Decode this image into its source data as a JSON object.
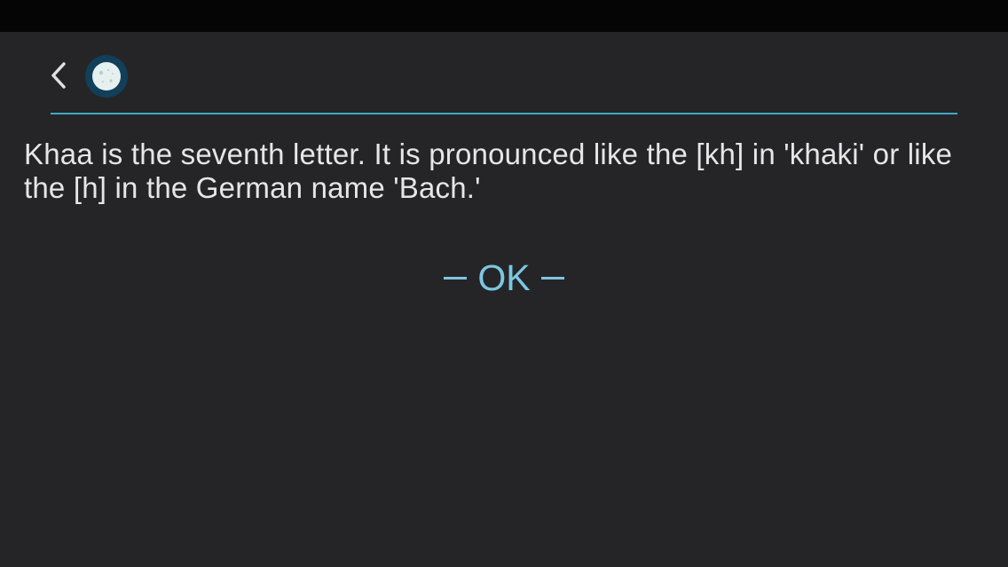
{
  "header": {
    "back_icon": "chevron-left-icon",
    "avatar_icon": "moon-icon",
    "accent_color": "#3fa8c8"
  },
  "main": {
    "message": "Khaa is the seventh letter. It is pronounced like the [kh] in 'khaki' or like the [h] in the German name 'Bach.'",
    "ok_label": "OK"
  },
  "colors": {
    "background": "#252527",
    "status_bar": "#050505",
    "text": "#e6e6e6",
    "button": "#7cc7e2"
  }
}
